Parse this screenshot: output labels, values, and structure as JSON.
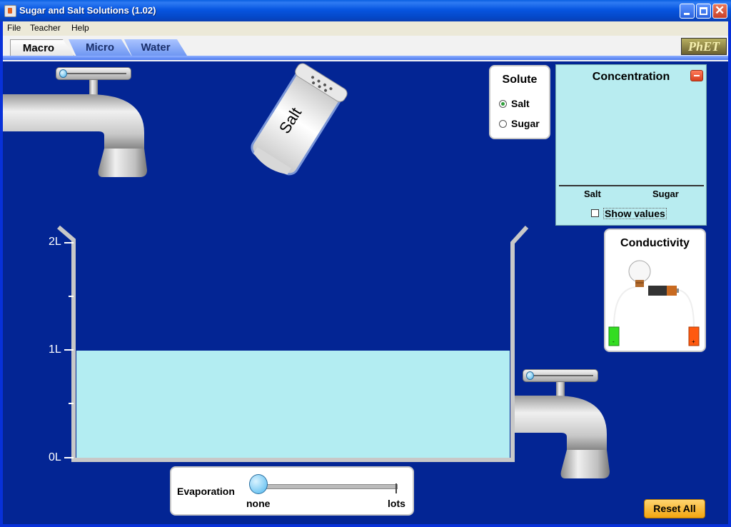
{
  "window": {
    "title": "Sugar and Salt Solutions (1.02)"
  },
  "menu": {
    "items": [
      "File",
      "Teacher",
      "Help"
    ]
  },
  "tabs": {
    "items": [
      "Macro",
      "Micro",
      "Water"
    ],
    "selected": "Macro",
    "logo": "PhET"
  },
  "shaker": {
    "label": "Salt"
  },
  "solute": {
    "title": "Solute",
    "options": [
      "Salt",
      "Sugar"
    ],
    "selected": "Salt"
  },
  "concentration": {
    "title": "Concentration",
    "categories": [
      "Salt",
      "Sugar"
    ],
    "show_values_label": "Show values",
    "show_values_checked": false
  },
  "conductivity": {
    "title": "Conductivity",
    "negative_symbol": "-",
    "positive_symbol": "+"
  },
  "beaker": {
    "tick_labels": [
      "2L",
      "1L",
      "0L"
    ],
    "water_volume_liters": 1,
    "max_liters": 2
  },
  "evaporation": {
    "label": "Evaporation",
    "min_label": "none",
    "max_label": "lots",
    "value": 0
  },
  "faucets": {
    "input_flow": 0,
    "drain_flow": 0
  },
  "reset_button": {
    "label": "Reset All"
  },
  "colors": {
    "background": "#032594",
    "water": "#b3edf2",
    "concentration_panel": "#b8ecf0",
    "reset_button": "#f5b02a",
    "battery_negative": "#33dd22",
    "battery_positive": "#ff5a10"
  }
}
